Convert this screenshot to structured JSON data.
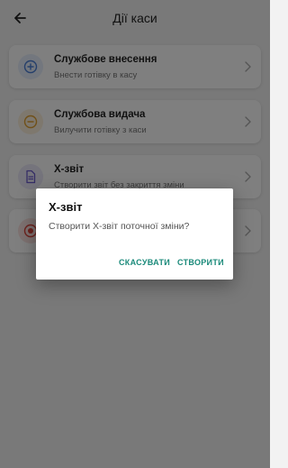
{
  "header": {
    "title": "Дії каси",
    "back_icon": "arrow-left-icon"
  },
  "actions": [
    {
      "title": "Службове внесення",
      "subtitle": "Внести готівку в касу",
      "icon": "plus-circle-icon",
      "accent": "#4a7fd6",
      "bg": "#e6eefc"
    },
    {
      "title": "Службова видача",
      "subtitle": "Вилучити готівку з каси",
      "icon": "minus-circle-icon",
      "accent": "#e0a030",
      "bg": "#fdf1dc"
    },
    {
      "title": "X-звіт",
      "subtitle": "Створити звіт без закриття зміни",
      "icon": "document-icon",
      "accent": "#6a5acd",
      "bg": "#ebe8f8"
    },
    {
      "title": "",
      "subtitle": "",
      "icon": "stop-circle-icon",
      "accent": "#d9443a",
      "bg": "#fbe3e1"
    }
  ],
  "dialog": {
    "title": "X-звіт",
    "message": "Створити X-звіт поточної зміни?",
    "cancel_label": "СКАСУВАТИ",
    "create_label": "СТВОРИТИ",
    "button_color": "#1a8a7a"
  }
}
